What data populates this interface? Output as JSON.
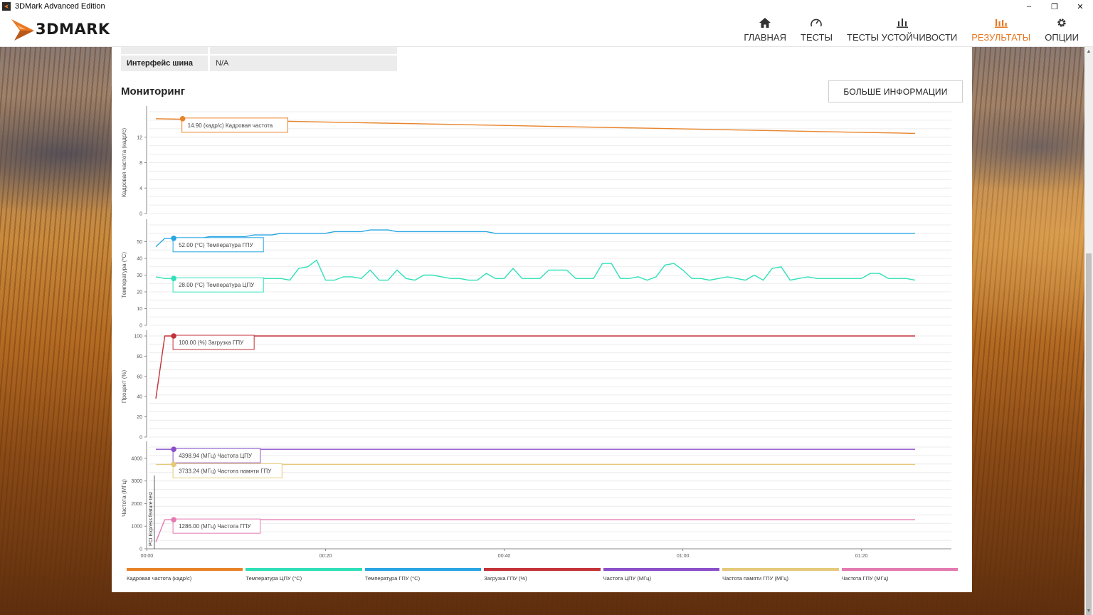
{
  "window": {
    "title": "3DMark Advanced Edition",
    "controls": {
      "minimize": "–",
      "restore": "❐",
      "close": "✕"
    }
  },
  "header": {
    "logo_text": "3DMARK",
    "nav": [
      {
        "label": "ГЛАВНАЯ",
        "icon": "home-icon",
        "active": false
      },
      {
        "label": "ТЕСТЫ",
        "icon": "gauge-icon",
        "active": false
      },
      {
        "label": "ТЕСТЫ УСТОЙЧИВОСТИ",
        "icon": "bars-icon",
        "active": false
      },
      {
        "label": "РЕЗУЛЬТАТЫ",
        "icon": "results-icon",
        "active": true
      },
      {
        "label": "ОПЦИИ",
        "icon": "gear-icon",
        "active": false
      }
    ],
    "accent_color": "#e87722"
  },
  "info_table": {
    "partial_row": {
      "key": "",
      "value": ""
    },
    "row": {
      "key": "Интерфейс шина",
      "value": "N/A"
    }
  },
  "monitoring": {
    "title": "Мониторинг",
    "more_button": "БОЛЬШЕ ИНФОРМАЦИИ"
  },
  "chart_data": [
    {
      "type": "line",
      "ylabel": "Кадровая частота (кадр/с)",
      "ylim": [
        0,
        16
      ],
      "yticks": [
        0,
        4,
        8,
        12
      ],
      "series": [
        {
          "name": "Кадровая частота (кадр/с)",
          "color": "#e8832a",
          "x": [
            0,
            85
          ],
          "values": [
            14.9,
            12.6
          ]
        }
      ],
      "tooltips": [
        {
          "text": "14.90 (кадр/с) Кадровая частота",
          "series": 0,
          "x": 3,
          "y": 14.9
        }
      ]
    },
    {
      "type": "line",
      "ylabel": "Температура (°C)",
      "ylim": [
        0,
        60
      ],
      "yticks": [
        0,
        10,
        20,
        30,
        40,
        50
      ],
      "series": [
        {
          "name": "Температура ГПУ (°C)",
          "color": "#29a5e3",
          "x": [
            0,
            1,
            2,
            3,
            4,
            5,
            6,
            7,
            8,
            9,
            10,
            11,
            12,
            13,
            14,
            15,
            16,
            17,
            18,
            19,
            20,
            21,
            22,
            23,
            24,
            25,
            26,
            27,
            28,
            29,
            30,
            31,
            32,
            33,
            34,
            35,
            36,
            37,
            38,
            39,
            40,
            85
          ],
          "values": [
            47,
            52,
            52,
            52,
            52,
            52,
            53,
            53,
            53,
            53,
            53,
            54,
            54,
            54,
            55,
            55,
            55,
            55,
            55,
            55,
            56,
            56,
            56,
            56,
            57,
            57,
            57,
            56,
            56,
            56,
            56,
            56,
            56,
            56,
            56,
            56,
            56,
            56,
            55,
            55,
            55,
            55
          ]
        },
        {
          "name": "Температура ЦПУ (°C)",
          "color": "#2fe0b8",
          "x": [
            0,
            1,
            2,
            3,
            4,
            5,
            6,
            7,
            8,
            9,
            10,
            11,
            12,
            13,
            14,
            15,
            16,
            17,
            18,
            19,
            20,
            21,
            22,
            23,
            24,
            25,
            26,
            27,
            28,
            29,
            30,
            31,
            32,
            33,
            34,
            35,
            36,
            37,
            38,
            39,
            40,
            41,
            42,
            43,
            44,
            45,
            46,
            47,
            48,
            49,
            50,
            51,
            52,
            53,
            54,
            55,
            56,
            57,
            58,
            59,
            60,
            61,
            62,
            63,
            64,
            65,
            66,
            67,
            68,
            69,
            70,
            71,
            72,
            73,
            74,
            75,
            76,
            77,
            78,
            79,
            80,
            81,
            82,
            83,
            84,
            85
          ],
          "values": [
            29,
            28,
            28,
            28,
            28,
            28,
            28,
            28,
            27,
            27,
            27,
            28,
            28,
            28,
            28,
            27,
            34,
            35,
            39,
            27,
            27,
            29,
            29,
            28,
            33,
            27,
            27,
            33,
            28,
            27,
            30,
            30,
            29,
            28,
            28,
            27,
            27,
            31,
            28,
            28,
            34,
            28,
            28,
            28,
            33,
            33,
            33,
            28,
            28,
            28,
            37,
            37,
            28,
            28,
            29,
            27,
            29,
            36,
            37,
            33,
            28,
            28,
            27,
            28,
            29,
            28,
            27,
            30,
            27,
            34,
            35,
            27,
            28,
            29,
            28,
            28,
            28,
            28,
            28,
            28,
            31,
            31,
            28,
            28,
            28,
            27
          ]
        }
      ],
      "tooltips": [
        {
          "text": "52.00 (°C) Температура ГПУ",
          "series": 0,
          "x": 2,
          "y": 52
        },
        {
          "text": "28.00 (°C) Температура ЦПУ",
          "series": 1,
          "x": 2,
          "y": 28
        }
      ]
    },
    {
      "type": "line",
      "ylabel": "Процент (%)",
      "ylim": [
        0,
        100
      ],
      "yticks": [
        0,
        20,
        40,
        60,
        80,
        100
      ],
      "series": [
        {
          "name": "Загрузка ГПУ (%)",
          "color": "#c4323a",
          "x": [
            0,
            1,
            2,
            85
          ],
          "values": [
            38,
            100,
            100,
            100
          ]
        }
      ],
      "tooltips": [
        {
          "text": "100.00 (%) Загрузка ГПУ",
          "series": 0,
          "x": 2,
          "y": 100
        }
      ]
    },
    {
      "type": "line",
      "ylabel": "Частота (МГц)",
      "ylim": [
        0,
        4500
      ],
      "yticks": [
        0,
        1000,
        2000,
        3000,
        4000
      ],
      "xlabel": "",
      "xticks": [
        "00:00",
        "00:20",
        "00:40",
        "01:00",
        "01:20"
      ],
      "xtick_values": [
        -1,
        19,
        39,
        59,
        79
      ],
      "marker_text": "PCI Express feature test",
      "series": [
        {
          "name": "Частота ЦПУ (МГц)",
          "color": "#8b4fc9",
          "x": [
            0,
            85
          ],
          "values": [
            4398.94,
            4398.94
          ]
        },
        {
          "name": "Частота памяти ГПУ (МГц)",
          "color": "#e5c97a",
          "x": [
            0,
            85
          ],
          "values": [
            3733.24,
            3733.24
          ]
        },
        {
          "name": "Частота ГПУ (МГц)",
          "color": "#e47ab0",
          "x": [
            0,
            1,
            85
          ],
          "values": [
            300,
            1286,
            1286
          ]
        }
      ],
      "tooltips": [
        {
          "text": "4398.94 (МГц) Частота ЦПУ",
          "series": 0,
          "x": 2,
          "y": 4398.94
        },
        {
          "text": "3733.24 (МГц) Частота памяти ГПУ",
          "series": 1,
          "x": 2,
          "y": 3733.24
        },
        {
          "text": "1286.00 (МГц) Частота ГПУ",
          "series": 2,
          "x": 2,
          "y": 1286
        }
      ]
    }
  ],
  "legend": [
    {
      "label": "Кадровая частота (кадр/с)",
      "color": "#e8832a"
    },
    {
      "label": "Температура ЦПУ (°C)",
      "color": "#2fe0b8"
    },
    {
      "label": "Температура ГПУ (°C)",
      "color": "#29a5e3"
    },
    {
      "label": "Загрузка ГПУ (%)",
      "color": "#c4323a"
    },
    {
      "label": "Частота ЦПУ (МГц)",
      "color": "#8b4fc9"
    },
    {
      "label": "Частота памяти ГПУ (МГц)",
      "color": "#e5c97a"
    },
    {
      "label": "Частота ГПУ (МГц)",
      "color": "#e47ab0"
    }
  ]
}
